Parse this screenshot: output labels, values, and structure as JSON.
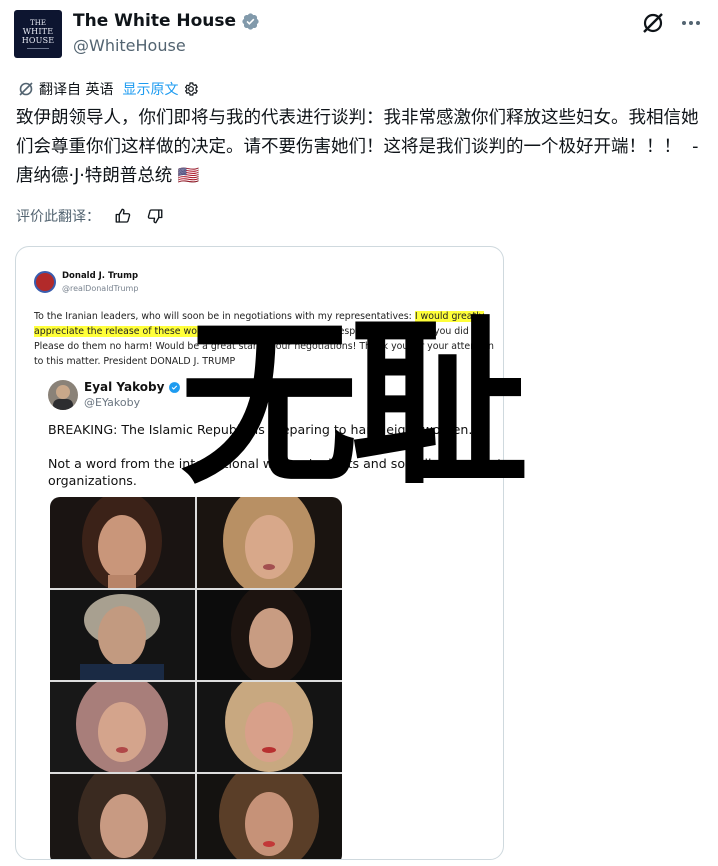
{
  "account": {
    "display_name": "The White House",
    "handle": "@WhiteHouse",
    "avatar_line1": "THE",
    "avatar_line2": "WHITE",
    "avatar_line3": "HOUSE"
  },
  "translation": {
    "label": "翻译自 英语",
    "show_original": "显示原文"
  },
  "tweet": {
    "text": "致伊朗领导人，你们即将与我的代表进行谈判：我非常感激你们释放这些妇女。我相信她们会尊重你们这样做的决定。请不要伤害她们！这将是我们谈判的一个极好开端！！！  - 唐纳德·J·特朗普总统 🇺🇸"
  },
  "rating": {
    "label": "评价此翻译："
  },
  "embedded_post": {
    "author_name": "Donald J. Trump",
    "author_handle": "@realDonaldTrump",
    "text_before": "To the Iranian leaders, who will soon be in negotiations with my representatives: ",
    "text_highlight": "I would greatly appreciate the release of these women",
    "text_after": ". I am sure that they will respect the fact that you did so. Please do them no harm! Would be a great start to our negotiations! Thank you for your attention to this matter. President DONALD J. TRUMP"
  },
  "quoted_post": {
    "author_name": "Eyal Yakoby",
    "author_handle": "@EYakoby",
    "line1": "BREAKING: The Islamic Republic is preparing to hang eight women.",
    "line2": "Not a word from the international women's rights and so-called feminist",
    "line3": "organizations."
  },
  "overlay_text": "无耻",
  "colors": {
    "accent": "#1d9bf0",
    "verified_gray": "#829aab",
    "highlight": "#ffff3a",
    "text": "#0f1419",
    "muted": "#536471"
  },
  "icons": [
    "grok-icon",
    "more-icon",
    "translate-icon",
    "gear-icon",
    "thumbs-up-icon",
    "thumbs-down-icon",
    "verified-icon"
  ]
}
